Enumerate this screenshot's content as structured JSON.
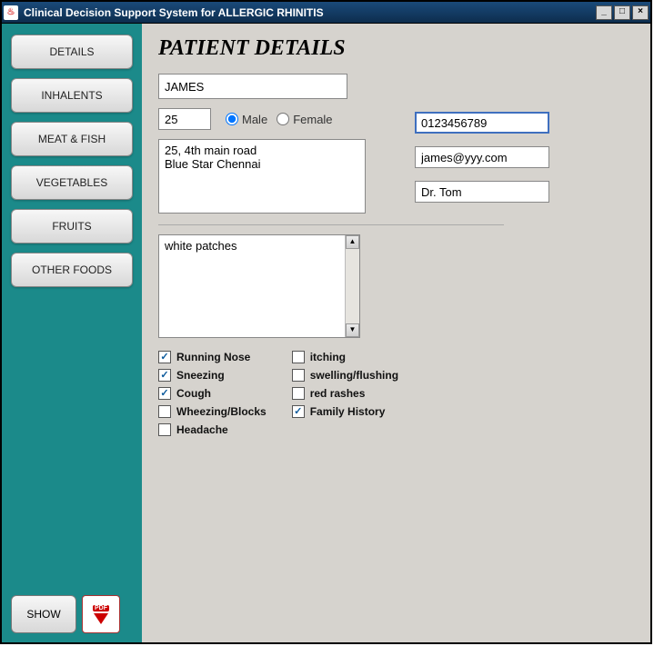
{
  "window": {
    "title": "Clinical Decision Support System for ALLERGIC RHINITIS"
  },
  "sidebar": {
    "items": [
      {
        "label": "DETAILS"
      },
      {
        "label": "INHALENTS"
      },
      {
        "label": "MEAT & FISH"
      },
      {
        "label": "VEGETABLES"
      },
      {
        "label": "FRUITS"
      },
      {
        "label": "OTHER FOODS"
      }
    ],
    "show_label": "SHOW"
  },
  "main": {
    "heading": "PATIENT DETAILS",
    "name": "JAMES",
    "age": "25",
    "gender": {
      "male_label": "Male",
      "female_label": "Female",
      "selected": "male"
    },
    "phone": "0123456789",
    "email": "james@yyy.com",
    "doctor": "Dr. Tom",
    "address": "25, 4th main road\nBlue Star Chennai",
    "symptoms_text": "white patches",
    "symptoms": {
      "col1": [
        {
          "label": "Running Nose",
          "checked": true
        },
        {
          "label": "Sneezing",
          "checked": true
        },
        {
          "label": "Cough",
          "checked": true
        },
        {
          "label": "Wheezing/Blocks",
          "checked": false
        },
        {
          "label": "Headache",
          "checked": false
        }
      ],
      "col2": [
        {
          "label": "itching",
          "checked": false
        },
        {
          "label": "swelling/flushing",
          "checked": false
        },
        {
          "label": "red rashes",
          "checked": false
        },
        {
          "label": "Family History",
          "checked": true
        }
      ]
    }
  }
}
